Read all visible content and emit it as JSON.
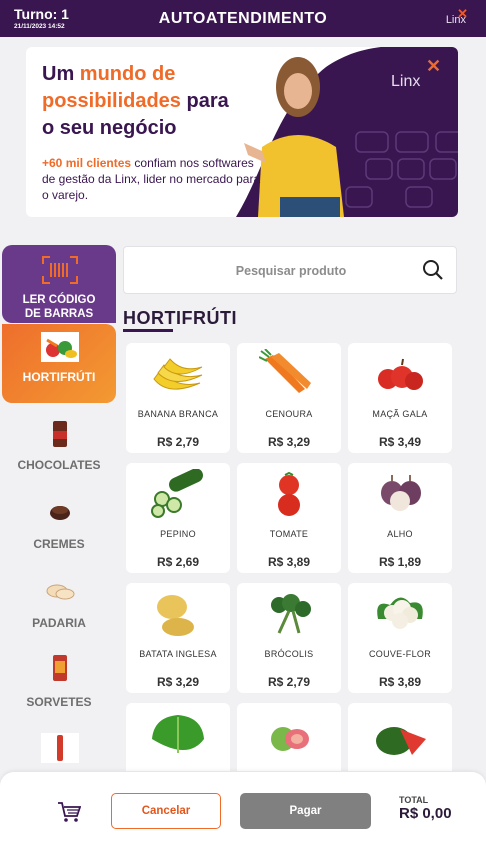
{
  "header": {
    "turno": "Turno: 1",
    "datetime": "21/11/2023 14:52",
    "title": "AUTOATENDIMENTO",
    "logo": "Linx"
  },
  "banner": {
    "line1_a": "Um ",
    "line1_b": "mundo de",
    "line2_a": "possibilidades",
    "line2_b": " para",
    "line3": "o seu negócio",
    "sub_highlight": "+60 mil clientes",
    "sub_rest": " confiam nos softwares de gestão da Linx, lider no mercado para o varejo.",
    "logo": "Linx"
  },
  "sidebar": {
    "barcode_label_1": "LER CÓDIGO",
    "barcode_label_2": "DE BARRAS",
    "items": [
      {
        "label": "HORTIFRÚTI",
        "icon": "vegetables-icon"
      },
      {
        "label": "CHOCOLATES",
        "icon": "chocolate-icon"
      },
      {
        "label": "CREMES",
        "icon": "cream-icon"
      },
      {
        "label": "PADARIA",
        "icon": "bread-icon"
      },
      {
        "label": "SORVETES",
        "icon": "ice-cream-icon"
      },
      {
        "label": "",
        "icon": "bottle-icon"
      }
    ]
  },
  "search": {
    "placeholder": "Pesquisar produto"
  },
  "section": {
    "title": "HORTIFRÚTI"
  },
  "products": [
    {
      "name": "BANANA BRANCA",
      "price": "R$ 2,79",
      "icon": "banana-icon"
    },
    {
      "name": "CENOURA",
      "price": "R$ 3,29",
      "icon": "carrot-icon"
    },
    {
      "name": "MAÇÃ GALA",
      "price": "R$ 3,49",
      "icon": "apple-icon"
    },
    {
      "name": "PEPINO",
      "price": "R$ 2,69",
      "icon": "cucumber-icon"
    },
    {
      "name": "TOMATE",
      "price": "R$ 3,89",
      "icon": "tomato-icon"
    },
    {
      "name": "ALHO",
      "price": "R$ 1,89",
      "icon": "garlic-icon"
    },
    {
      "name": "BATATA INGLESA",
      "price": "R$ 3,29",
      "icon": "potato-icon"
    },
    {
      "name": "BRÓCOLIS",
      "price": "R$ 2,79",
      "icon": "broccoli-icon"
    },
    {
      "name": "COUVE-FLOR",
      "price": "R$ 3,89",
      "icon": "cauliflower-icon"
    },
    {
      "name": "",
      "price": "",
      "icon": "lettuce-icon"
    },
    {
      "name": "",
      "price": "",
      "icon": "guava-icon"
    },
    {
      "name": "",
      "price": "",
      "icon": "watermelon-icon"
    }
  ],
  "footer": {
    "cancel_label": "Cancelar",
    "pay_label": "Pagar",
    "total_label": "TOTAL",
    "total_value": "R$ 0,00"
  },
  "colors": {
    "brand_purple": "#3a1650",
    "accent_orange": "#f06a28",
    "pay_disabled": "#808080"
  }
}
